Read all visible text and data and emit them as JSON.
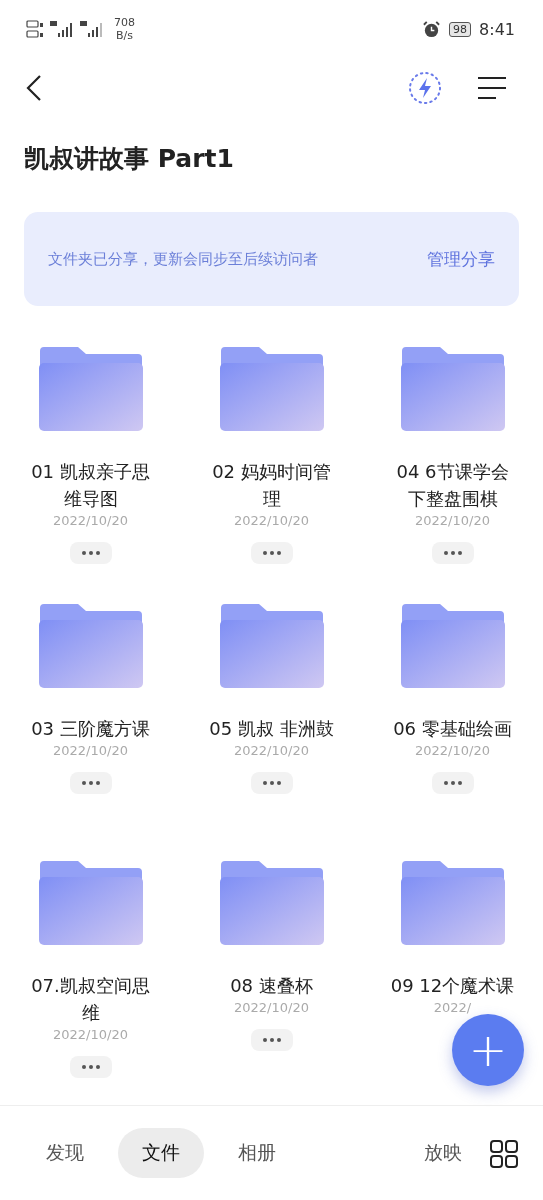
{
  "status_bar": {
    "net_speed": "708",
    "net_unit": "B/s",
    "battery": "98",
    "time": "8:41"
  },
  "title": "凯叔讲故事 Part1",
  "share_banner": {
    "message": "文件夹已分享，更新会同步至后续访问者",
    "action": "管理分享"
  },
  "folders": [
    {
      "name": "01 凯叔亲子思维导图",
      "date": "2022/10/20",
      "more_button": true
    },
    {
      "name": "02 妈妈时间管理",
      "date": "2022/10/20",
      "more_button": true
    },
    {
      "name": "04 6节课学会下整盘围棋",
      "date": "2022/10/20",
      "more_button": true
    },
    {
      "name": "03 三阶魔方课",
      "date": "2022/10/20",
      "more_button": true
    },
    {
      "name": "05 凯叔 非洲鼓",
      "date": "2022/10/20",
      "more_button": true
    },
    {
      "name": "06 零基础绘画",
      "date": "2022/10/20",
      "more_button": true
    },
    {
      "name": "07.凯叔空间思维",
      "date": "2022/10/20",
      "more_button": true
    },
    {
      "name": "08 速叠杯",
      "date": "2022/10/20",
      "more_button": true
    },
    {
      "name": "09 12个魔术课",
      "date": "2022/",
      "more_button": false
    }
  ],
  "fab": {
    "label": "+"
  },
  "tabs": [
    {
      "label": "发现",
      "selected": false
    },
    {
      "label": "文件",
      "selected": true
    },
    {
      "label": "相册",
      "selected": false
    },
    {
      "label": "放映",
      "selected": false
    }
  ]
}
